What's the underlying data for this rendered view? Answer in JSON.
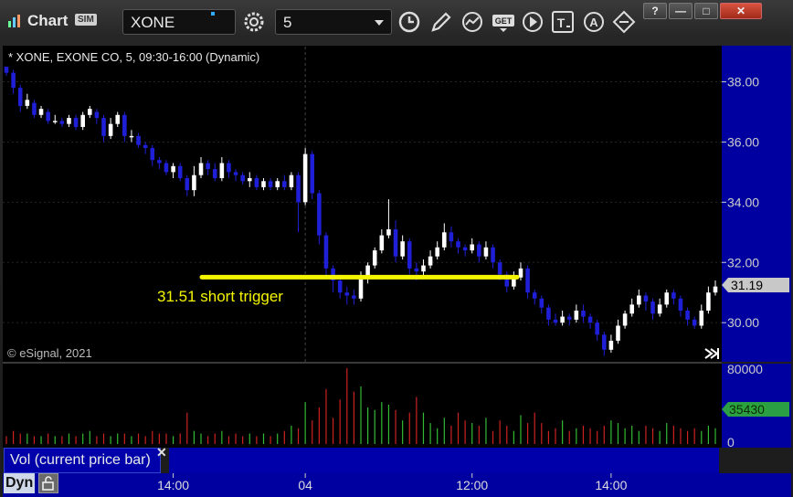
{
  "window": {
    "title": "Chart",
    "sim_badge": "SIM",
    "symbol": "XONE",
    "interval": "5",
    "buttons": {
      "help": "?",
      "minimize": "—",
      "maximize": "□",
      "close": "✕"
    }
  },
  "toolbar_icons": [
    "clock-icon",
    "pencil-icon",
    "study-icon",
    "get-icon",
    "play-icon",
    "text-icon",
    "alert-icon",
    "link-icon"
  ],
  "chart": {
    "header": "* XONE, EXONE CO, 5, 09:30-16:00 (Dynamic)",
    "copyright": "© eSignal, 2021",
    "annotation_text": "31.51 short trigger",
    "annotation_color": "#f5f500",
    "last_price": "31.19",
    "volume_last": "35430",
    "volume_label": "Vol (current price bar)",
    "volume_axis_max": "80000",
    "volume_axis_min": "0",
    "volume_axis_ghost": "40000",
    "dyn_label": "Dyn",
    "colors": {
      "up": "#ffffff",
      "down": "#1f1fd8",
      "background": "#000000",
      "vol_up": "#33bb33",
      "vol_down": "#cc2222"
    }
  },
  "chart_data": {
    "type": "candlestick",
    "symbol": "XONE",
    "ylim": [
      28.7,
      39.2
    ],
    "y_ticks": [
      "38.00",
      "36.00",
      "34.00",
      "32.00",
      "30.00"
    ],
    "x_ticks": [
      "14:00",
      "04",
      "12:00",
      "14:00"
    ],
    "trigger_level": 31.51,
    "candles": [
      {
        "o": 38.5,
        "c": 38.3,
        "h": 38.5,
        "l": 38.2
      },
      {
        "o": 38.3,
        "c": 37.8,
        "h": 38.4,
        "l": 37.6
      },
      {
        "o": 37.8,
        "c": 37.2,
        "h": 37.9,
        "l": 37.0
      },
      {
        "o": 37.2,
        "c": 37.4,
        "h": 37.6,
        "l": 37.1
      },
      {
        "o": 37.3,
        "c": 36.9,
        "h": 37.4,
        "l": 36.8
      },
      {
        "o": 36.9,
        "c": 37.1,
        "h": 37.2,
        "l": 36.8
      },
      {
        "o": 37.0,
        "c": 36.7,
        "h": 37.1,
        "l": 36.6
      },
      {
        "o": 36.7,
        "c": 36.7,
        "h": 36.9,
        "l": 36.6
      },
      {
        "o": 36.7,
        "c": 36.6,
        "h": 36.8,
        "l": 36.5
      },
      {
        "o": 36.6,
        "c": 36.8,
        "h": 36.9,
        "l": 36.5
      },
      {
        "o": 36.8,
        "c": 36.5,
        "h": 36.9,
        "l": 36.4
      },
      {
        "o": 36.5,
        "c": 36.9,
        "h": 37.0,
        "l": 36.4
      },
      {
        "o": 36.9,
        "c": 37.1,
        "h": 37.2,
        "l": 36.8
      },
      {
        "o": 37.0,
        "c": 36.8,
        "h": 37.1,
        "l": 36.6
      },
      {
        "o": 36.8,
        "c": 36.2,
        "h": 36.9,
        "l": 36.0
      },
      {
        "o": 36.2,
        "c": 36.6,
        "h": 36.8,
        "l": 36.1
      },
      {
        "o": 36.6,
        "c": 36.9,
        "h": 37.0,
        "l": 36.5
      },
      {
        "o": 36.9,
        "c": 36.2,
        "h": 37.0,
        "l": 36.0
      },
      {
        "o": 36.2,
        "c": 36.2,
        "h": 36.4,
        "l": 36.0
      },
      {
        "o": 36.2,
        "c": 35.9,
        "h": 36.3,
        "l": 35.8
      },
      {
        "o": 35.9,
        "c": 35.8,
        "h": 36.0,
        "l": 35.6
      },
      {
        "o": 35.8,
        "c": 35.4,
        "h": 35.9,
        "l": 35.2
      },
      {
        "o": 35.4,
        "c": 35.3,
        "h": 35.5,
        "l": 35.1
      },
      {
        "o": 35.3,
        "c": 35.0,
        "h": 35.4,
        "l": 34.9
      },
      {
        "o": 35.0,
        "c": 35.2,
        "h": 35.3,
        "l": 34.8
      },
      {
        "o": 35.2,
        "c": 34.8,
        "h": 35.3,
        "l": 34.7
      },
      {
        "o": 34.8,
        "c": 34.4,
        "h": 34.9,
        "l": 34.2
      },
      {
        "o": 34.4,
        "c": 34.9,
        "h": 35.2,
        "l": 34.2
      },
      {
        "o": 34.9,
        "c": 35.3,
        "h": 35.5,
        "l": 34.8
      },
      {
        "o": 35.3,
        "c": 35.1,
        "h": 35.4,
        "l": 34.9
      },
      {
        "o": 35.1,
        "c": 34.8,
        "h": 35.3,
        "l": 34.7
      },
      {
        "o": 34.8,
        "c": 35.3,
        "h": 35.5,
        "l": 34.7
      },
      {
        "o": 35.3,
        "c": 35.0,
        "h": 35.4,
        "l": 34.8
      },
      {
        "o": 35.0,
        "c": 34.9,
        "h": 35.1,
        "l": 34.7
      },
      {
        "o": 34.9,
        "c": 34.7,
        "h": 35.0,
        "l": 34.6
      },
      {
        "o": 34.7,
        "c": 34.8,
        "h": 35.0,
        "l": 34.5
      },
      {
        "o": 34.8,
        "c": 34.5,
        "h": 34.9,
        "l": 34.4
      },
      {
        "o": 34.5,
        "c": 34.7,
        "h": 34.8,
        "l": 34.4
      },
      {
        "o": 34.7,
        "c": 34.5,
        "h": 34.8,
        "l": 34.4
      },
      {
        "o": 34.5,
        "c": 34.7,
        "h": 34.8,
        "l": 34.4
      },
      {
        "o": 34.7,
        "c": 34.5,
        "h": 34.9,
        "l": 34.4
      },
      {
        "o": 34.5,
        "c": 34.9,
        "h": 35.0,
        "l": 34.4
      },
      {
        "o": 34.9,
        "c": 34.0,
        "h": 35.0,
        "l": 33.0
      },
      {
        "o": 34.0,
        "c": 35.6,
        "h": 35.8,
        "l": 33.9
      },
      {
        "o": 35.6,
        "c": 34.3,
        "h": 35.7,
        "l": 34.1
      },
      {
        "o": 34.3,
        "c": 32.9,
        "h": 34.4,
        "l": 32.6
      },
      {
        "o": 32.9,
        "c": 31.8,
        "h": 33.0,
        "l": 31.5
      },
      {
        "o": 31.8,
        "c": 31.4,
        "h": 31.9,
        "l": 31.0
      },
      {
        "o": 31.4,
        "c": 31.0,
        "h": 31.6,
        "l": 30.8
      },
      {
        "o": 31.0,
        "c": 30.9,
        "h": 31.2,
        "l": 30.6
      },
      {
        "o": 30.9,
        "c": 30.8,
        "h": 31.1,
        "l": 30.6
      },
      {
        "o": 30.8,
        "c": 31.5,
        "h": 31.7,
        "l": 30.7
      },
      {
        "o": 31.5,
        "c": 31.9,
        "h": 32.0,
        "l": 31.3
      },
      {
        "o": 31.9,
        "c": 32.4,
        "h": 32.5,
        "l": 31.8
      },
      {
        "o": 32.4,
        "c": 32.9,
        "h": 33.1,
        "l": 32.3
      },
      {
        "o": 32.9,
        "c": 33.1,
        "h": 34.1,
        "l": 32.8
      },
      {
        "o": 33.1,
        "c": 32.2,
        "h": 33.4,
        "l": 32.0
      },
      {
        "o": 32.2,
        "c": 32.7,
        "h": 32.9,
        "l": 32.1
      },
      {
        "o": 32.7,
        "c": 31.8,
        "h": 32.8,
        "l": 31.6
      },
      {
        "o": 31.8,
        "c": 31.7,
        "h": 32.0,
        "l": 31.4
      },
      {
        "o": 31.7,
        "c": 31.9,
        "h": 32.1,
        "l": 31.5
      },
      {
        "o": 31.9,
        "c": 32.2,
        "h": 32.4,
        "l": 31.8
      },
      {
        "o": 32.2,
        "c": 32.5,
        "h": 32.7,
        "l": 32.1
      },
      {
        "o": 32.5,
        "c": 33.0,
        "h": 33.3,
        "l": 32.4
      },
      {
        "o": 33.0,
        "c": 32.7,
        "h": 33.2,
        "l": 32.5
      },
      {
        "o": 32.7,
        "c": 32.5,
        "h": 32.8,
        "l": 32.3
      },
      {
        "o": 32.5,
        "c": 32.4,
        "h": 32.6,
        "l": 32.2
      },
      {
        "o": 32.4,
        "c": 32.6,
        "h": 32.8,
        "l": 32.3
      },
      {
        "o": 32.6,
        "c": 32.2,
        "h": 32.7,
        "l": 32.0
      },
      {
        "o": 32.2,
        "c": 32.5,
        "h": 32.7,
        "l": 32.1
      },
      {
        "o": 32.5,
        "c": 32.0,
        "h": 32.6,
        "l": 31.8
      },
      {
        "o": 32.0,
        "c": 31.6,
        "h": 32.1,
        "l": 31.4
      },
      {
        "o": 31.6,
        "c": 31.2,
        "h": 31.7,
        "l": 31.0
      },
      {
        "o": 31.2,
        "c": 31.5,
        "h": 31.7,
        "l": 31.1
      },
      {
        "o": 31.5,
        "c": 31.8,
        "h": 32.0,
        "l": 31.4
      },
      {
        "o": 31.8,
        "c": 31.0,
        "h": 31.9,
        "l": 30.8
      },
      {
        "o": 31.0,
        "c": 30.8,
        "h": 31.1,
        "l": 30.6
      },
      {
        "o": 30.8,
        "c": 30.5,
        "h": 30.9,
        "l": 30.3
      },
      {
        "o": 30.5,
        "c": 30.1,
        "h": 30.6,
        "l": 29.9
      },
      {
        "o": 30.1,
        "c": 30.0,
        "h": 30.3,
        "l": 29.9
      },
      {
        "o": 30.0,
        "c": 30.2,
        "h": 30.4,
        "l": 29.9
      },
      {
        "o": 30.2,
        "c": 30.1,
        "h": 30.3,
        "l": 29.9
      },
      {
        "o": 30.1,
        "c": 30.4,
        "h": 30.6,
        "l": 30.0
      },
      {
        "o": 30.4,
        "c": 30.2,
        "h": 30.6,
        "l": 30.0
      },
      {
        "o": 30.2,
        "c": 30.0,
        "h": 30.3,
        "l": 29.8
      },
      {
        "o": 30.0,
        "c": 29.6,
        "h": 30.1,
        "l": 29.4
      },
      {
        "o": 29.6,
        "c": 29.1,
        "h": 29.7,
        "l": 28.9
      },
      {
        "o": 29.1,
        "c": 29.4,
        "h": 29.6,
        "l": 29.0
      },
      {
        "o": 29.4,
        "c": 29.9,
        "h": 30.1,
        "l": 29.3
      },
      {
        "o": 29.9,
        "c": 30.3,
        "h": 30.4,
        "l": 29.8
      },
      {
        "o": 30.3,
        "c": 30.6,
        "h": 30.8,
        "l": 30.2
      },
      {
        "o": 30.6,
        "c": 30.9,
        "h": 31.1,
        "l": 30.5
      },
      {
        "o": 30.9,
        "c": 30.7,
        "h": 31.0,
        "l": 30.4
      },
      {
        "o": 30.7,
        "c": 30.3,
        "h": 30.8,
        "l": 30.1
      },
      {
        "o": 30.3,
        "c": 30.6,
        "h": 30.8,
        "l": 30.2
      },
      {
        "o": 30.6,
        "c": 31.0,
        "h": 31.1,
        "l": 30.5
      },
      {
        "o": 31.0,
        "c": 30.8,
        "h": 31.1,
        "l": 30.6
      },
      {
        "o": 30.8,
        "c": 30.4,
        "h": 30.9,
        "l": 30.2
      },
      {
        "o": 30.4,
        "c": 30.1,
        "h": 30.5,
        "l": 29.9
      },
      {
        "o": 30.1,
        "c": 29.9,
        "h": 30.2,
        "l": 29.8
      },
      {
        "o": 29.9,
        "c": 30.4,
        "h": 30.6,
        "l": 29.8
      },
      {
        "o": 30.4,
        "c": 31.0,
        "h": 31.2,
        "l": 30.3
      },
      {
        "o": 31.0,
        "c": 31.2,
        "h": 31.4,
        "l": 30.9
      }
    ],
    "volume": [
      3,
      5,
      4,
      4,
      3,
      3,
      4,
      3,
      3,
      4,
      3,
      4,
      5,
      3,
      4,
      3,
      4,
      4,
      3,
      4,
      3,
      5,
      4,
      4,
      3,
      4,
      12,
      5,
      4,
      3,
      4,
      5,
      3,
      4,
      3,
      4,
      3,
      4,
      3,
      4,
      5,
      7,
      6,
      16,
      9,
      14,
      21,
      10,
      17,
      29,
      20,
      22,
      14,
      13,
      16,
      15,
      13,
      9,
      12,
      18,
      12,
      8,
      6,
      10,
      7,
      12,
      9,
      8,
      7,
      10,
      5,
      9,
      7,
      5,
      11,
      8,
      12,
      8,
      5,
      6,
      9,
      5,
      6,
      7,
      6,
      5,
      7,
      9,
      8,
      6,
      7,
      5,
      7,
      6,
      5,
      8,
      7,
      6,
      5,
      6,
      5,
      7,
      6,
      4,
      5,
      8,
      6
    ],
    "volume_ylim": [
      0,
      80000
    ]
  }
}
